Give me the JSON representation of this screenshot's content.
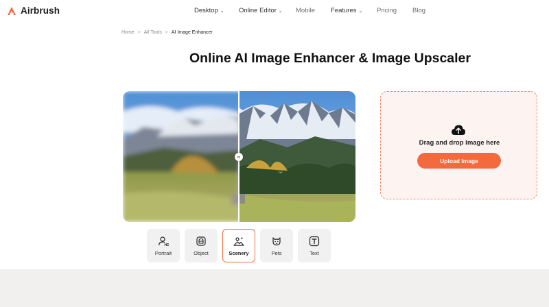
{
  "header": {
    "logo_text": "Airbrush",
    "nav": [
      {
        "label": "Desktop",
        "has_dropdown": true
      },
      {
        "label": "Online Editor",
        "has_dropdown": true
      },
      {
        "label": "Mobile",
        "has_dropdown": false
      },
      {
        "label": "Features",
        "has_dropdown": true
      },
      {
        "label": "Pricing",
        "has_dropdown": false
      },
      {
        "label": "Blog",
        "has_dropdown": false
      }
    ],
    "dropdown_glyph": "⌄"
  },
  "breadcrumb": {
    "items": [
      "Home",
      "All Tools",
      "AI Image Enhancer"
    ],
    "separator": ">"
  },
  "page_title": "Online AI Image Enhancer & Image Upscaler",
  "compare": {
    "handle_glyph": "‹›",
    "split_fraction": 0.5
  },
  "upload": {
    "drop_text": "Drag and drop Image here",
    "button_label": "Upload Image"
  },
  "categories": [
    {
      "label": "Portrait",
      "icon": "portrait-hd-icon",
      "active": false
    },
    {
      "label": "Object",
      "icon": "object-icon",
      "active": false
    },
    {
      "label": "Scenery",
      "icon": "scenery-icon",
      "active": true
    },
    {
      "label": "Pets",
      "icon": "pets-icon",
      "active": false
    },
    {
      "label": "Text",
      "icon": "text-icon",
      "active": false
    }
  ],
  "colors": {
    "accent": "#f26a3d",
    "upload_bg": "#fdf4f1",
    "upload_border": "#f08a6c",
    "tab_bg": "#f1f1f1",
    "footer_band": "#f1f0ef"
  }
}
